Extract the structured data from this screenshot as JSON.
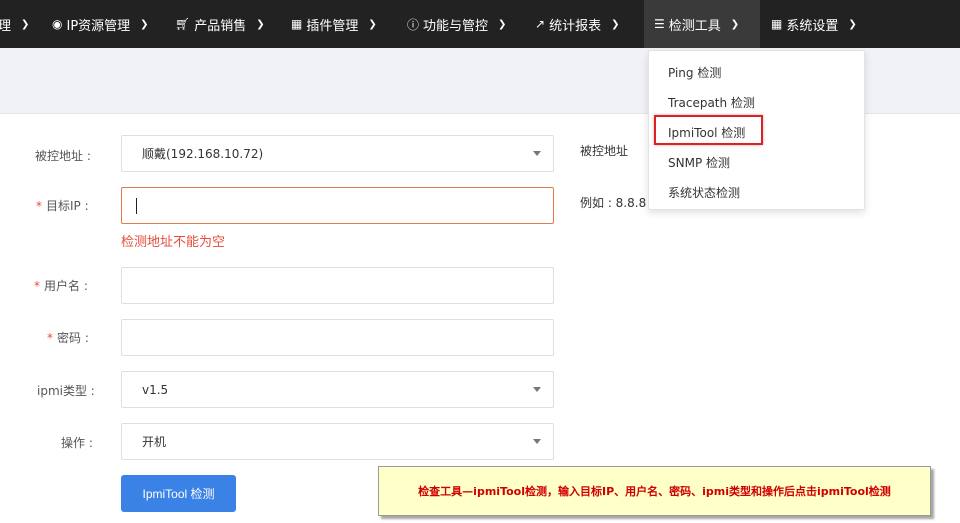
{
  "nav": {
    "items": [
      {
        "icon": "",
        "label": "理"
      },
      {
        "icon": "map-marker",
        "label": "IP资源管理"
      },
      {
        "icon": "shopping-cart",
        "label": "产品销售"
      },
      {
        "icon": "grid",
        "label": "插件管理"
      },
      {
        "icon": "info-circle",
        "label": "功能与管控"
      },
      {
        "icon": "line-chart",
        "label": "统计报表"
      },
      {
        "icon": "list",
        "label": "检测工具"
      },
      {
        "icon": "windows-grid",
        "label": "系统设置"
      }
    ],
    "active_index": 6
  },
  "dropdown": {
    "items": [
      "Ping 检测",
      "Tracepath 检测",
      "IpmiTool 检测",
      "SNMP 检测",
      "系统状态检测"
    ],
    "highlighted_index": 2
  },
  "form": {
    "controlled_address": {
      "label": "被控地址 :",
      "value": "顺戴(192.168.10.72)"
    },
    "target_ip": {
      "label": "目标IP :",
      "value": "",
      "error": "检测地址不能为空"
    },
    "username": {
      "label": "用户名 :",
      "value": ""
    },
    "password": {
      "label": "密码 :",
      "value": ""
    },
    "ipmi_type": {
      "label": "ipmi类型 :",
      "value": "v1.5"
    },
    "action": {
      "label": "操作 :",
      "value": "开机"
    },
    "submit_label": "IpmiTool 检测"
  },
  "right_panel": {
    "controlled_address_label": "被控地址",
    "example_text": "例如 : 8.8.8"
  },
  "annotation": "检查工具—ipmiTool检测，输入目标IP、用户名、密码、ipmi类型和操作后点击ipmiTool检测",
  "colors": {
    "nav_bg": "#222222",
    "accent": "#3b82e6",
    "error": "#e74c3c",
    "highlight": "#e02020"
  }
}
